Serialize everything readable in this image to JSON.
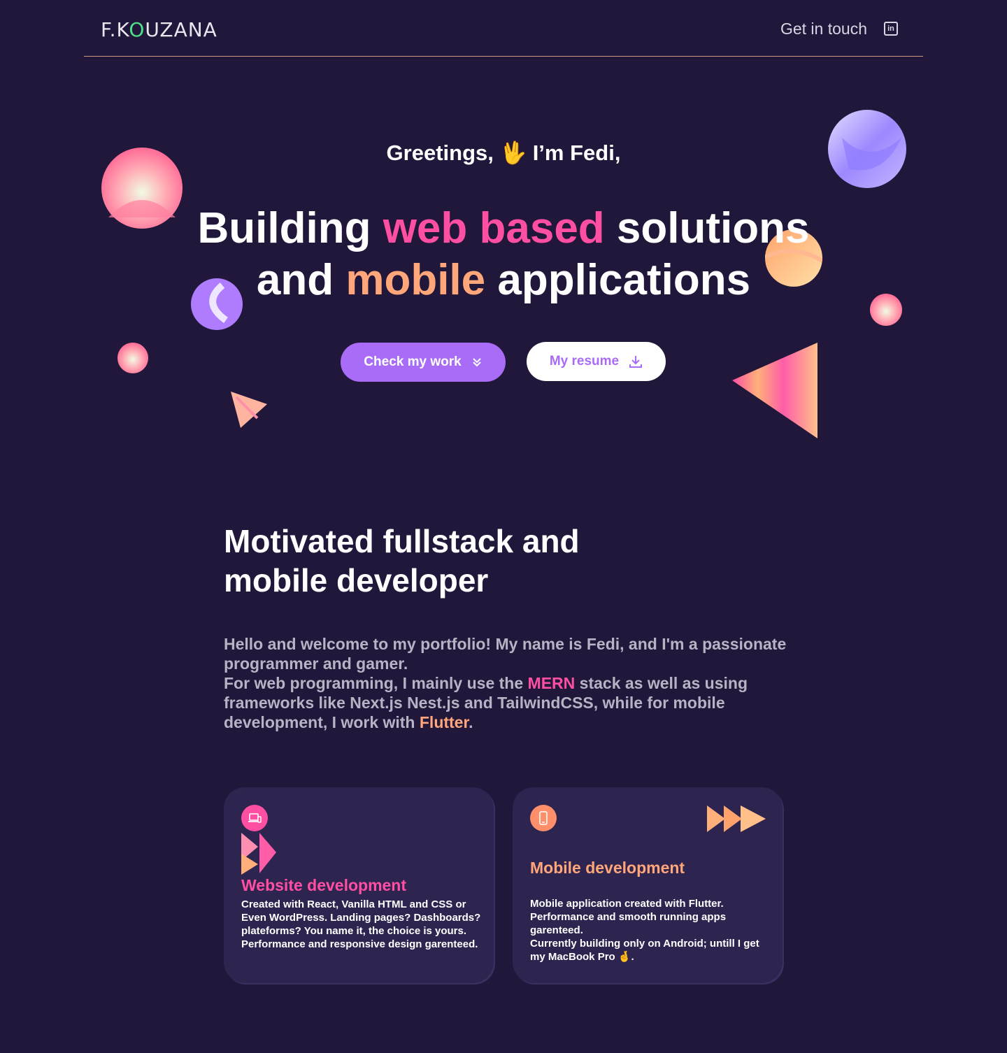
{
  "header": {
    "logo": {
      "part1": "F.K",
      "part2": "O",
      "part3": "UZANA"
    },
    "contact_label": "Get in touch",
    "linkedin_icon": "linkedin-icon"
  },
  "hero": {
    "greeting": "Greetings, 🖖 I’m Fedi,",
    "headline": {
      "t1": "Building ",
      "t2": "web based",
      "t3": " solutions",
      "t4": "and ",
      "t5": "mobile",
      "t6": " applications"
    },
    "primary_button": "Check my work",
    "secondary_button": "My resume"
  },
  "about": {
    "title_line1": "Motivated fullstack and",
    "title_line2": "mobile developer",
    "p1": "Hello and welcome to my portfolio! My name is Fedi, and I'm a passionate programmer and gamer.",
    "p2a": "For web programming, I mainly use the ",
    "p2_mern": "MERN",
    "p2b": " stack as well as using frameworks like Next.js Nest.js and TailwindCSS, while for mobile development, I work with ",
    "p2_flutter": "Flutter",
    "p2c": "."
  },
  "cards": [
    {
      "icon": "laptop-icon",
      "title": "Website development",
      "desc": "Created with React, Vanilla HTML and CSS or Even WordPress. Landing pages? Dashboards? plateforms? You name it, the choice is yours. Performance and responsive design garenteed."
    },
    {
      "icon": "phone-icon",
      "title": "Mobile development",
      "desc_line1": "Mobile application created with Flutter. Performance and smooth running apps garenteed.",
      "desc_line2": "Currently building only on Android; untill I get my MacBook Pro 🤞."
    }
  ],
  "colors": {
    "background": "#21173a",
    "accent_pink": "#ff4fa2",
    "accent_orange": "#ffa77a",
    "accent_purple": "#a86cf6",
    "card_bg": "#2e2450"
  }
}
